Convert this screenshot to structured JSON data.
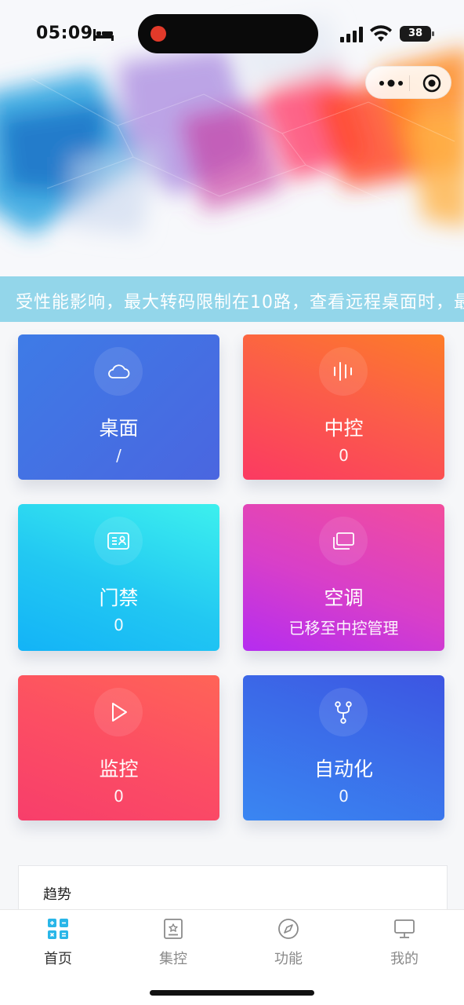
{
  "status_bar": {
    "time": "05:09",
    "battery": "38"
  },
  "marquee": {
    "text": "受性能影响，最大转码限制在10路，查看远程桌面时，最"
  },
  "cards": [
    {
      "title": "桌面",
      "value": "/",
      "icon": "cloud-icon"
    },
    {
      "title": "中控",
      "value": "0",
      "icon": "waveform-icon"
    },
    {
      "title": "门禁",
      "value": "0",
      "icon": "id-card-icon"
    },
    {
      "title": "空调",
      "value": "已移至中控管理",
      "icon": "monitor-stack-icon"
    },
    {
      "title": "监控",
      "value": "0",
      "icon": "play-icon"
    },
    {
      "title": "自动化",
      "value": "0",
      "icon": "fork-icon"
    }
  ],
  "trend": {
    "label": "趋势"
  },
  "tabbar": [
    {
      "label": "首页",
      "icon": "grid-icon",
      "active": true,
      "accent": "#29b6e8"
    },
    {
      "label": "集控",
      "icon": "control-panel-icon",
      "active": false
    },
    {
      "label": "功能",
      "icon": "compass-icon",
      "active": false
    },
    {
      "label": "我的",
      "icon": "computer-icon",
      "active": false
    }
  ]
}
